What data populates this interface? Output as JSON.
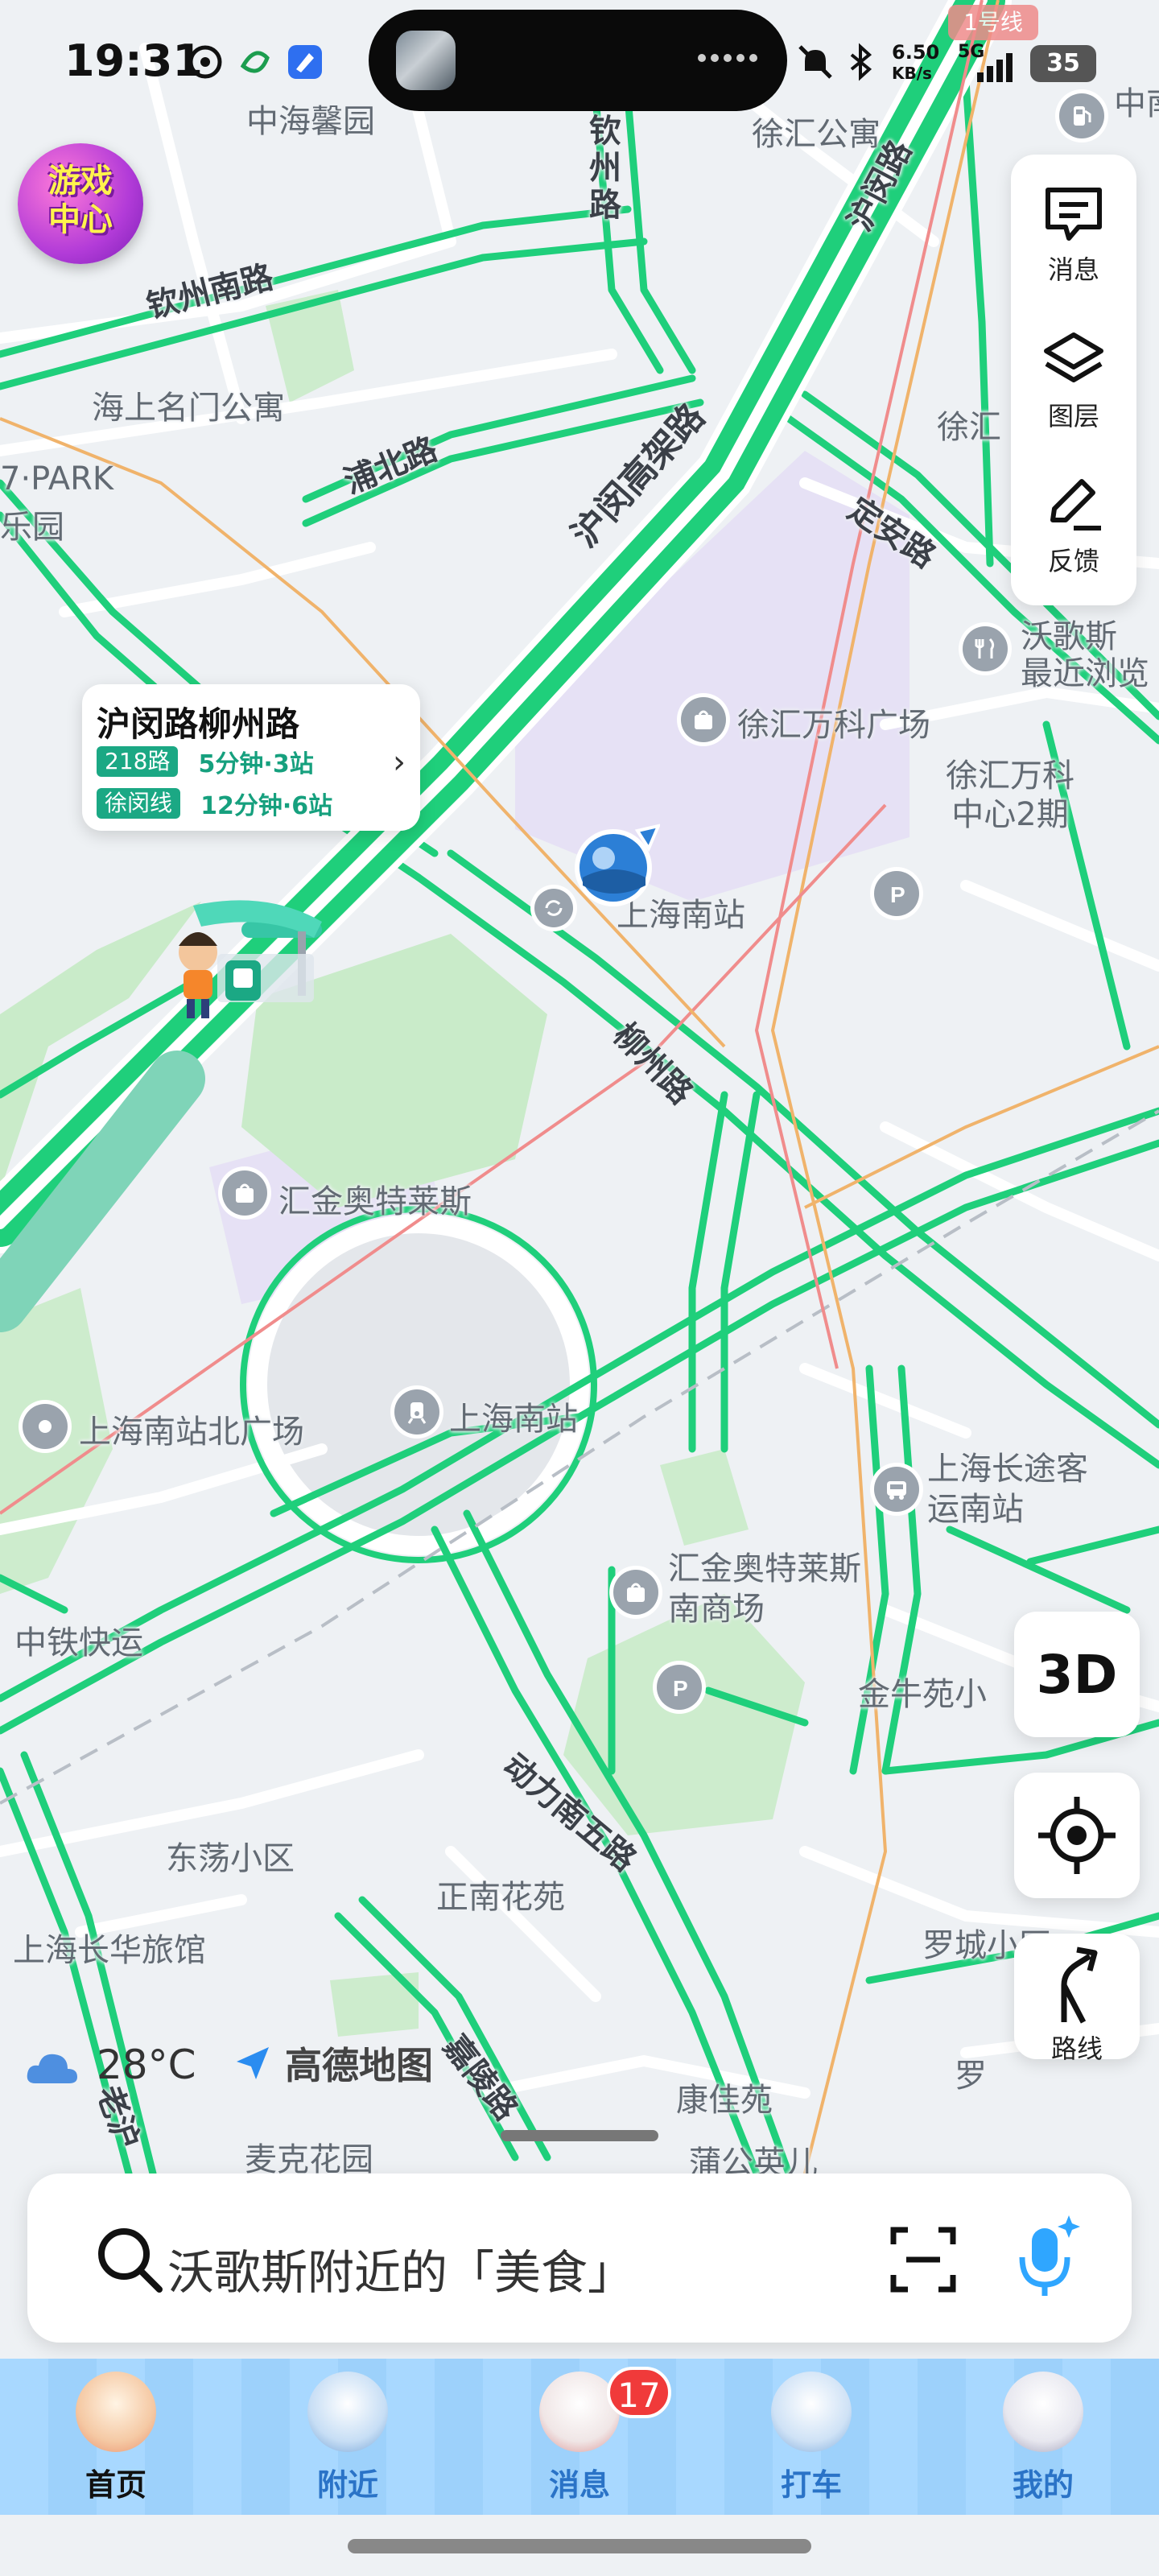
{
  "status_bar": {
    "time": "19:31",
    "net_speed": "6.50",
    "net_unit": "KB/s",
    "network": "5G",
    "battery": "35",
    "line_badge": "1号线"
  },
  "game_center": {
    "line1": "游戏",
    "line2": "中心"
  },
  "side_panel": {
    "messages": "消息",
    "layers": "图层",
    "feedback": "反馈"
  },
  "buttons": {
    "three_d": "3D",
    "route": "路线"
  },
  "stop_card": {
    "title": "沪闵路柳州路",
    "routes": [
      {
        "name": "218路",
        "eta": "5分钟·3站"
      },
      {
        "name": "徐闵线",
        "eta": "12分钟·6站"
      }
    ]
  },
  "map_labels": {
    "zhonghai_xinyuan": "中海馨园",
    "xuhui_gongyu": "徐汇公寓",
    "qinzhou_road_v": "钦州路",
    "humin_road_v": "沪闵路",
    "qinzhou_south_road": "钦州南路",
    "haishang_gongyu": "海上名门公寓",
    "pubei_road": "浦北路",
    "humin_elevated": "沪闵高架路",
    "xuhui_cut": "徐汇",
    "park": "7·PARK",
    "park_sub": "乐园",
    "dingan_road": "定安路",
    "wogesi": "沃歌斯",
    "recent_browse": "最近浏览",
    "xuhui_vanke": "徐汇万科广场",
    "xuhui_vanke_center": "徐汇万科中心2期",
    "shanghai_south_station_top": "上海南站",
    "liuzhou_road": "柳州路",
    "huijin_outlet": "汇金奥特莱斯",
    "ssn_north_square": "上海南站北广场",
    "shanghai_south_station": "上海南站",
    "long_distance_bus": "上海长途客运南站",
    "huijin_south_mall": "汇金奥特莱斯南商场",
    "zhongtie_express": "中铁快运",
    "jinniu_yuan": "金牛苑小",
    "dongli_south_5": "动力南五路",
    "dongdang": "东荡小区",
    "zhengnan": "正南花苑",
    "changhua_hotel": "上海长华旅馆",
    "luocheng": "罗城小区",
    "jialing_road": "嘉陵路",
    "kangjia": "康佳苑",
    "luo": "罗",
    "maike": "麦克花园",
    "pugong_ying": "蒲公英儿",
    "laoshan": "老沪",
    "zhongnan": "中南"
  },
  "weather": {
    "temp": "28°C"
  },
  "brand": {
    "name": "高德地图"
  },
  "search": {
    "placeholder": "沃歌斯附近的「美食」"
  },
  "bottom_nav": [
    {
      "label": "首页",
      "active": true
    },
    {
      "label": "附近"
    },
    {
      "label": "消息",
      "badge": "17"
    },
    {
      "label": "打车"
    },
    {
      "label": "我的"
    }
  ],
  "colors": {
    "road_green": "#1fcf7b",
    "road_white": "#ffffff",
    "map_bg": "#eef1f4",
    "poi_purple": "#e9e4f7",
    "park_green": "#c9ebc9",
    "nav_active": "#111111",
    "nav_inactive": "#2a73c7"
  }
}
